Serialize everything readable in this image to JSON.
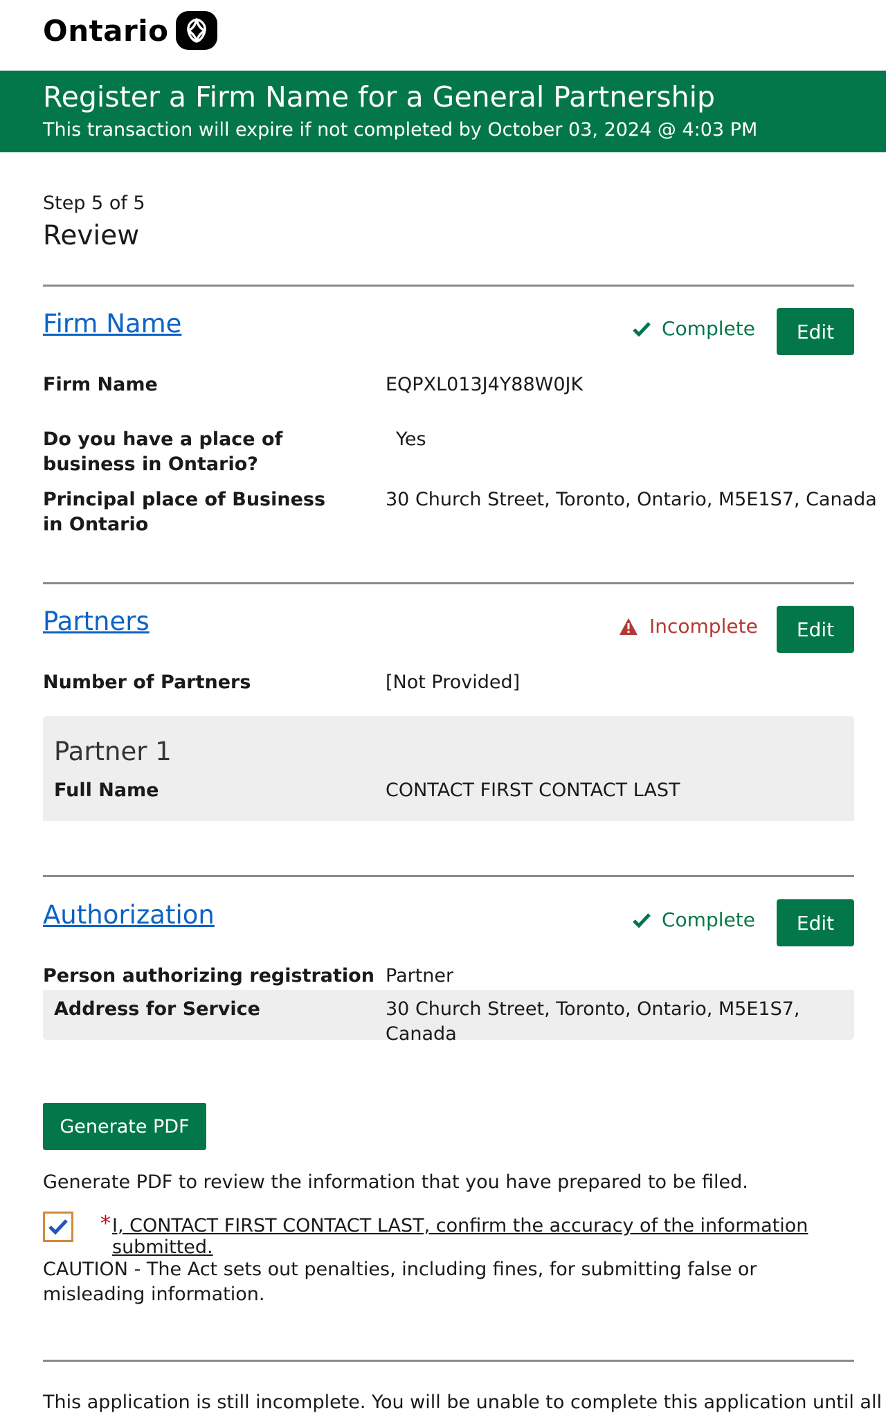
{
  "header": {
    "logo_text": "Ontario",
    "title": "Register a Firm Name for a General Partnership",
    "expiry": "This transaction will expire if not completed by October 03, 2024 @ 4:03 PM"
  },
  "step": {
    "label": "Step 5 of 5",
    "title": "Review"
  },
  "colors": {
    "brand_green": "#04774a",
    "link_blue": "#0b63c4",
    "incomplete_red": "#b33a34"
  },
  "sections": {
    "firm": {
      "title": "Firm Name",
      "status": "Complete",
      "status_icon": "check-icon",
      "edit_label": "Edit",
      "fields": [
        {
          "label": "Firm Name",
          "value": "EQPXL013J4Y88W0JK"
        },
        {
          "label": "Do you have a place of business in Ontario?",
          "value": "Yes"
        },
        {
          "label": "Principal place of Business in Ontario",
          "value": "30 Church Street, Toronto, Ontario, M5E1S7, Canada"
        }
      ]
    },
    "partners": {
      "title": "Partners",
      "status": "Incomplete",
      "status_icon": "warning-icon",
      "edit_label": "Edit",
      "number_label": "Number of Partners",
      "number_value": "[Not Provided]",
      "partner1": {
        "title": "Partner 1",
        "full_name_label": "Full Name",
        "full_name_value": "CONTACT FIRST CONTACT LAST"
      }
    },
    "authorization": {
      "title": "Authorization",
      "status": "Complete",
      "status_icon": "check-icon",
      "edit_label": "Edit",
      "person_label": "Person authorizing registration",
      "person_value": "Partner",
      "address_label": "Address for Service",
      "address_value": "30 Church Street, Toronto, Ontario, M5E1S7, Canada"
    }
  },
  "pdf": {
    "button_label": "Generate PDF",
    "note": "Generate PDF to review the information that you have prepared to be filed."
  },
  "confirm": {
    "checked": true,
    "required_mark": "*",
    "text": "I, CONTACT FIRST CONTACT LAST, confirm the accuracy of the information submitted."
  },
  "caution": "CAUTION - The Act sets out penalties, including fines, for submitting false or misleading information.",
  "footer_partial": "This application is still incomplete. You will be unable to complete this application until all"
}
